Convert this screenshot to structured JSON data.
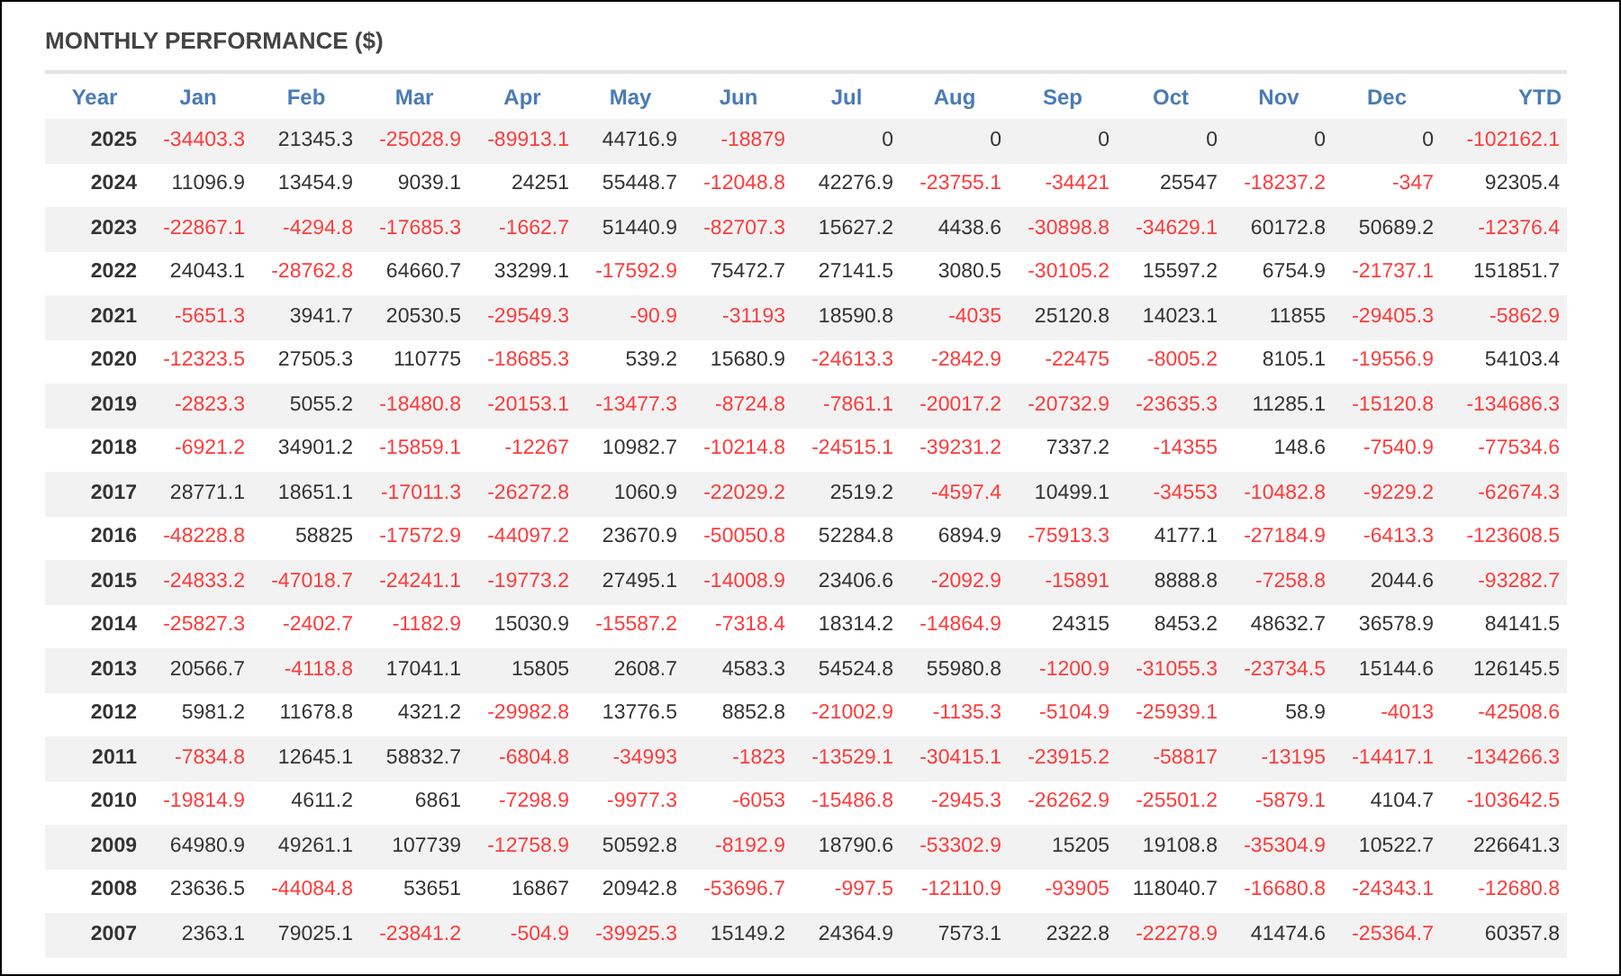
{
  "title": "MONTHLY PERFORMANCE ($)",
  "columns": [
    "Year",
    "Jan",
    "Feb",
    "Mar",
    "Apr",
    "May",
    "Jun",
    "Jul",
    "Aug",
    "Sep",
    "Oct",
    "Nov",
    "Dec",
    "YTD"
  ],
  "rows": [
    {
      "year": "2025",
      "cells": [
        {
          "value": "-34403.3",
          "negative": true
        },
        {
          "value": "21345.3",
          "negative": false
        },
        {
          "value": "-25028.9",
          "negative": true
        },
        {
          "value": "-89913.1",
          "negative": true
        },
        {
          "value": "44716.9",
          "negative": false
        },
        {
          "value": "-18879",
          "negative": true
        },
        {
          "value": "0",
          "negative": false
        },
        {
          "value": "0",
          "negative": false
        },
        {
          "value": "0",
          "negative": false
        },
        {
          "value": "0",
          "negative": false
        },
        {
          "value": "0",
          "negative": false
        },
        {
          "value": "0",
          "negative": false
        },
        {
          "value": "-102162.1",
          "negative": true
        }
      ]
    },
    {
      "year": "2024",
      "cells": [
        {
          "value": "11096.9",
          "negative": false
        },
        {
          "value": "13454.9",
          "negative": false
        },
        {
          "value": "9039.1",
          "negative": false
        },
        {
          "value": "24251",
          "negative": false
        },
        {
          "value": "55448.7",
          "negative": false
        },
        {
          "value": "-12048.8",
          "negative": true
        },
        {
          "value": "42276.9",
          "negative": false
        },
        {
          "value": "-23755.1",
          "negative": true
        },
        {
          "value": "-34421",
          "negative": true
        },
        {
          "value": "25547",
          "negative": false
        },
        {
          "value": "-18237.2",
          "negative": true
        },
        {
          "value": "-347",
          "negative": true
        },
        {
          "value": "92305.4",
          "negative": false
        }
      ]
    },
    {
      "year": "2023",
      "cells": [
        {
          "value": "-22867.1",
          "negative": true
        },
        {
          "value": "-4294.8",
          "negative": true
        },
        {
          "value": "-17685.3",
          "negative": true
        },
        {
          "value": "-1662.7",
          "negative": true
        },
        {
          "value": "51440.9",
          "negative": false
        },
        {
          "value": "-82707.3",
          "negative": true
        },
        {
          "value": "15627.2",
          "negative": false
        },
        {
          "value": "4438.6",
          "negative": false
        },
        {
          "value": "-30898.8",
          "negative": true
        },
        {
          "value": "-34629.1",
          "negative": true
        },
        {
          "value": "60172.8",
          "negative": false
        },
        {
          "value": "50689.2",
          "negative": false
        },
        {
          "value": "-12376.4",
          "negative": true
        }
      ]
    },
    {
      "year": "2022",
      "cells": [
        {
          "value": "24043.1",
          "negative": false
        },
        {
          "value": "-28762.8",
          "negative": true
        },
        {
          "value": "64660.7",
          "negative": false
        },
        {
          "value": "33299.1",
          "negative": false
        },
        {
          "value": "-17592.9",
          "negative": true
        },
        {
          "value": "75472.7",
          "negative": false
        },
        {
          "value": "27141.5",
          "negative": false
        },
        {
          "value": "3080.5",
          "negative": false
        },
        {
          "value": "-30105.2",
          "negative": true
        },
        {
          "value": "15597.2",
          "negative": false
        },
        {
          "value": "6754.9",
          "negative": false
        },
        {
          "value": "-21737.1",
          "negative": true
        },
        {
          "value": "151851.7",
          "negative": false
        }
      ]
    },
    {
      "year": "2021",
      "cells": [
        {
          "value": "-5651.3",
          "negative": true
        },
        {
          "value": "3941.7",
          "negative": false
        },
        {
          "value": "20530.5",
          "negative": false
        },
        {
          "value": "-29549.3",
          "negative": true
        },
        {
          "value": "-90.9",
          "negative": true
        },
        {
          "value": "-31193",
          "negative": true
        },
        {
          "value": "18590.8",
          "negative": false
        },
        {
          "value": "-4035",
          "negative": true
        },
        {
          "value": "25120.8",
          "negative": false
        },
        {
          "value": "14023.1",
          "negative": false
        },
        {
          "value": "11855",
          "negative": false
        },
        {
          "value": "-29405.3",
          "negative": true
        },
        {
          "value": "-5862.9",
          "negative": true
        }
      ]
    },
    {
      "year": "2020",
      "cells": [
        {
          "value": "-12323.5",
          "negative": true
        },
        {
          "value": "27505.3",
          "negative": false
        },
        {
          "value": "110775",
          "negative": false
        },
        {
          "value": "-18685.3",
          "negative": true
        },
        {
          "value": "539.2",
          "negative": false
        },
        {
          "value": "15680.9",
          "negative": false
        },
        {
          "value": "-24613.3",
          "negative": true
        },
        {
          "value": "-2842.9",
          "negative": true
        },
        {
          "value": "-22475",
          "negative": true
        },
        {
          "value": "-8005.2",
          "negative": true
        },
        {
          "value": "8105.1",
          "negative": false
        },
        {
          "value": "-19556.9",
          "negative": true
        },
        {
          "value": "54103.4",
          "negative": false
        }
      ]
    },
    {
      "year": "2019",
      "cells": [
        {
          "value": "-2823.3",
          "negative": true
        },
        {
          "value": "5055.2",
          "negative": false
        },
        {
          "value": "-18480.8",
          "negative": true
        },
        {
          "value": "-20153.1",
          "negative": true
        },
        {
          "value": "-13477.3",
          "negative": true
        },
        {
          "value": "-8724.8",
          "negative": true
        },
        {
          "value": "-7861.1",
          "negative": true
        },
        {
          "value": "-20017.2",
          "negative": true
        },
        {
          "value": "-20732.9",
          "negative": true
        },
        {
          "value": "-23635.3",
          "negative": true
        },
        {
          "value": "11285.1",
          "negative": false
        },
        {
          "value": "-15120.8",
          "negative": true
        },
        {
          "value": "-134686.3",
          "negative": true
        }
      ]
    },
    {
      "year": "2018",
      "cells": [
        {
          "value": "-6921.2",
          "negative": true
        },
        {
          "value": "34901.2",
          "negative": false
        },
        {
          "value": "-15859.1",
          "negative": true
        },
        {
          "value": "-12267",
          "negative": true
        },
        {
          "value": "10982.7",
          "negative": false
        },
        {
          "value": "-10214.8",
          "negative": true
        },
        {
          "value": "-24515.1",
          "negative": true
        },
        {
          "value": "-39231.2",
          "negative": true
        },
        {
          "value": "7337.2",
          "negative": false
        },
        {
          "value": "-14355",
          "negative": true
        },
        {
          "value": "148.6",
          "negative": false
        },
        {
          "value": "-7540.9",
          "negative": true
        },
        {
          "value": "-77534.6",
          "negative": true
        }
      ]
    },
    {
      "year": "2017",
      "cells": [
        {
          "value": "28771.1",
          "negative": false
        },
        {
          "value": "18651.1",
          "negative": false
        },
        {
          "value": "-17011.3",
          "negative": true
        },
        {
          "value": "-26272.8",
          "negative": true
        },
        {
          "value": "1060.9",
          "negative": false
        },
        {
          "value": "-22029.2",
          "negative": true
        },
        {
          "value": "2519.2",
          "negative": false
        },
        {
          "value": "-4597.4",
          "negative": true
        },
        {
          "value": "10499.1",
          "negative": false
        },
        {
          "value": "-34553",
          "negative": true
        },
        {
          "value": "-10482.8",
          "negative": true
        },
        {
          "value": "-9229.2",
          "negative": true
        },
        {
          "value": "-62674.3",
          "negative": true
        }
      ]
    },
    {
      "year": "2016",
      "cells": [
        {
          "value": "-48228.8",
          "negative": true
        },
        {
          "value": "58825",
          "negative": false
        },
        {
          "value": "-17572.9",
          "negative": true
        },
        {
          "value": "-44097.2",
          "negative": true
        },
        {
          "value": "23670.9",
          "negative": false
        },
        {
          "value": "-50050.8",
          "negative": true
        },
        {
          "value": "52284.8",
          "negative": false
        },
        {
          "value": "6894.9",
          "negative": false
        },
        {
          "value": "-75913.3",
          "negative": true
        },
        {
          "value": "4177.1",
          "negative": false
        },
        {
          "value": "-27184.9",
          "negative": true
        },
        {
          "value": "-6413.3",
          "negative": true
        },
        {
          "value": "-123608.5",
          "negative": true
        }
      ]
    },
    {
      "year": "2015",
      "cells": [
        {
          "value": "-24833.2",
          "negative": true
        },
        {
          "value": "-47018.7",
          "negative": true
        },
        {
          "value": "-24241.1",
          "negative": true
        },
        {
          "value": "-19773.2",
          "negative": true
        },
        {
          "value": "27495.1",
          "negative": false
        },
        {
          "value": "-14008.9",
          "negative": true
        },
        {
          "value": "23406.6",
          "negative": false
        },
        {
          "value": "-2092.9",
          "negative": true
        },
        {
          "value": "-15891",
          "negative": true
        },
        {
          "value": "8888.8",
          "negative": false
        },
        {
          "value": "-7258.8",
          "negative": true
        },
        {
          "value": "2044.6",
          "negative": false
        },
        {
          "value": "-93282.7",
          "negative": true
        }
      ]
    },
    {
      "year": "2014",
      "cells": [
        {
          "value": "-25827.3",
          "negative": true
        },
        {
          "value": "-2402.7",
          "negative": true
        },
        {
          "value": "-1182.9",
          "negative": true
        },
        {
          "value": "15030.9",
          "negative": false
        },
        {
          "value": "-15587.2",
          "negative": true
        },
        {
          "value": "-7318.4",
          "negative": true
        },
        {
          "value": "18314.2",
          "negative": false
        },
        {
          "value": "-14864.9",
          "negative": true
        },
        {
          "value": "24315",
          "negative": false
        },
        {
          "value": "8453.2",
          "negative": false
        },
        {
          "value": "48632.7",
          "negative": false
        },
        {
          "value": "36578.9",
          "negative": false
        },
        {
          "value": "84141.5",
          "negative": false
        }
      ]
    },
    {
      "year": "2013",
      "cells": [
        {
          "value": "20566.7",
          "negative": false
        },
        {
          "value": "-4118.8",
          "negative": true
        },
        {
          "value": "17041.1",
          "negative": false
        },
        {
          "value": "15805",
          "negative": false
        },
        {
          "value": "2608.7",
          "negative": false
        },
        {
          "value": "4583.3",
          "negative": false
        },
        {
          "value": "54524.8",
          "negative": false
        },
        {
          "value": "55980.8",
          "negative": false
        },
        {
          "value": "-1200.9",
          "negative": true
        },
        {
          "value": "-31055.3",
          "negative": true
        },
        {
          "value": "-23734.5",
          "negative": true
        },
        {
          "value": "15144.6",
          "negative": false
        },
        {
          "value": "126145.5",
          "negative": false
        }
      ]
    },
    {
      "year": "2012",
      "cells": [
        {
          "value": "5981.2",
          "negative": false
        },
        {
          "value": "11678.8",
          "negative": false
        },
        {
          "value": "4321.2",
          "negative": false
        },
        {
          "value": "-29982.8",
          "negative": true
        },
        {
          "value": "13776.5",
          "negative": false
        },
        {
          "value": "8852.8",
          "negative": false
        },
        {
          "value": "-21002.9",
          "negative": true
        },
        {
          "value": "-1135.3",
          "negative": true
        },
        {
          "value": "-5104.9",
          "negative": true
        },
        {
          "value": "-25939.1",
          "negative": true
        },
        {
          "value": "58.9",
          "negative": false
        },
        {
          "value": "-4013",
          "negative": true
        },
        {
          "value": "-42508.6",
          "negative": true
        }
      ]
    },
    {
      "year": "2011",
      "cells": [
        {
          "value": "-7834.8",
          "negative": true
        },
        {
          "value": "12645.1",
          "negative": false
        },
        {
          "value": "58832.7",
          "negative": false
        },
        {
          "value": "-6804.8",
          "negative": true
        },
        {
          "value": "-34993",
          "negative": true
        },
        {
          "value": "-1823",
          "negative": true
        },
        {
          "value": "-13529.1",
          "negative": true
        },
        {
          "value": "-30415.1",
          "negative": true
        },
        {
          "value": "-23915.2",
          "negative": true
        },
        {
          "value": "-58817",
          "negative": true
        },
        {
          "value": "-13195",
          "negative": true
        },
        {
          "value": "-14417.1",
          "negative": true
        },
        {
          "value": "-134266.3",
          "negative": true
        }
      ]
    },
    {
      "year": "2010",
      "cells": [
        {
          "value": "-19814.9",
          "negative": true
        },
        {
          "value": "4611.2",
          "negative": false
        },
        {
          "value": "6861",
          "negative": false
        },
        {
          "value": "-7298.9",
          "negative": true
        },
        {
          "value": "-9977.3",
          "negative": true
        },
        {
          "value": "-6053",
          "negative": true
        },
        {
          "value": "-15486.8",
          "negative": true
        },
        {
          "value": "-2945.3",
          "negative": true
        },
        {
          "value": "-26262.9",
          "negative": true
        },
        {
          "value": "-25501.2",
          "negative": true
        },
        {
          "value": "-5879.1",
          "negative": true
        },
        {
          "value": "4104.7",
          "negative": false
        },
        {
          "value": "-103642.5",
          "negative": true
        }
      ]
    },
    {
      "year": "2009",
      "cells": [
        {
          "value": "64980.9",
          "negative": false
        },
        {
          "value": "49261.1",
          "negative": false
        },
        {
          "value": "107739",
          "negative": false
        },
        {
          "value": "-12758.9",
          "negative": true
        },
        {
          "value": "50592.8",
          "negative": false
        },
        {
          "value": "-8192.9",
          "negative": true
        },
        {
          "value": "18790.6",
          "negative": false
        },
        {
          "value": "-53302.9",
          "negative": true
        },
        {
          "value": "15205",
          "negative": false
        },
        {
          "value": "19108.8",
          "negative": false
        },
        {
          "value": "-35304.9",
          "negative": true
        },
        {
          "value": "10522.7",
          "negative": false
        },
        {
          "value": "226641.3",
          "negative": false
        }
      ]
    },
    {
      "year": "2008",
      "cells": [
        {
          "value": "23636.5",
          "negative": false
        },
        {
          "value": "-44084.8",
          "negative": true
        },
        {
          "value": "53651",
          "negative": false
        },
        {
          "value": "16867",
          "negative": false
        },
        {
          "value": "20942.8",
          "negative": false
        },
        {
          "value": "-53696.7",
          "negative": true
        },
        {
          "value": "-997.5",
          "negative": true
        },
        {
          "value": "-12110.9",
          "negative": true
        },
        {
          "value": "-93905",
          "negative": true
        },
        {
          "value": "118040.7",
          "negative": false
        },
        {
          "value": "-16680.8",
          "negative": true
        },
        {
          "value": "-24343.1",
          "negative": true
        },
        {
          "value": "-12680.8",
          "negative": true
        }
      ]
    },
    {
      "year": "2007",
      "cells": [
        {
          "value": "2363.1",
          "negative": false
        },
        {
          "value": "79025.1",
          "negative": false
        },
        {
          "value": "-23841.2",
          "negative": true
        },
        {
          "value": "-504.9",
          "negative": true
        },
        {
          "value": "-39925.3",
          "negative": true
        },
        {
          "value": "15149.2",
          "negative": false
        },
        {
          "value": "24364.9",
          "negative": false
        },
        {
          "value": "7573.1",
          "negative": false
        },
        {
          "value": "2322.8",
          "negative": false
        },
        {
          "value": "-22278.9",
          "negative": true
        },
        {
          "value": "41474.6",
          "negative": false
        },
        {
          "value": "-25364.7",
          "negative": true
        },
        {
          "value": "60357.8",
          "negative": false
        }
      ]
    }
  ]
}
